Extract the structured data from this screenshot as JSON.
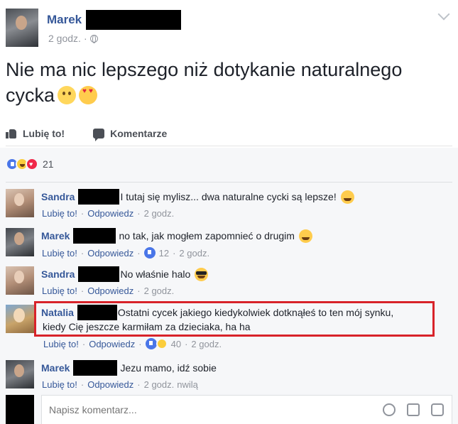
{
  "post": {
    "author": "Marek",
    "time": "2 godz.",
    "text": "Nie ma nic lepszego niż dotykanie naturalnego cycka",
    "emoji_icons": [
      "thinking-face-icon",
      "heart-eyes-icon"
    ]
  },
  "actions": {
    "like_label": "Lubię to!",
    "comment_label": "Komentarze"
  },
  "reactions": {
    "icons": [
      "like-icon",
      "haha-icon",
      "love-icon"
    ],
    "count": "21"
  },
  "comments": [
    {
      "author": "Sandra",
      "text": "I tutaj się mylisz... dwa naturalne cycki są lepsze!",
      "emoji": "laughing-face-icon",
      "like_label": "Lubię to!",
      "reply_label": "Odpowiedz",
      "time": "2 godz."
    },
    {
      "author": "Marek",
      "text": "no tak, jak mogłem zapomnieć o drugim",
      "emoji": "tongue-face-icon",
      "like_label": "Lubię to!",
      "reply_label": "Odpowiedz",
      "likes": "12",
      "time": "2 godz."
    },
    {
      "author": "Sandra",
      "text": "No właśnie halo",
      "emoji": "sunglasses-face-icon",
      "like_label": "Lubię to!",
      "reply_label": "Odpowiedz",
      "time": "2 godz."
    },
    {
      "author": "Natalia",
      "text": "Ostatni cycek jakiego kiedykolwiek dotknąłeś to ten mój synku,",
      "text2": "kiedy Cię jeszcze karmiłam za dzieciaka, ha ha",
      "like_label": "Lubię to!",
      "reply_label": "Odpowiedz",
      "likes": "40",
      "time": "2 godz.",
      "highlight_color": "#d8232a"
    },
    {
      "author": "Marek",
      "text": "Jezu mamo, idź sobie",
      "like_label": "Lubię to!",
      "reply_label": "Odpowiedz",
      "time": "2 godz.",
      "time_suffix": "nwilą"
    }
  ],
  "composer": {
    "placeholder": "Napisz komentarz...",
    "icons": [
      "emoji-icon",
      "camera-icon",
      "sticker-icon"
    ]
  },
  "colors": {
    "link": "#365899",
    "meta": "#90949c",
    "highlight": "#d8232a",
    "background_comments": "#f6f7f9"
  }
}
